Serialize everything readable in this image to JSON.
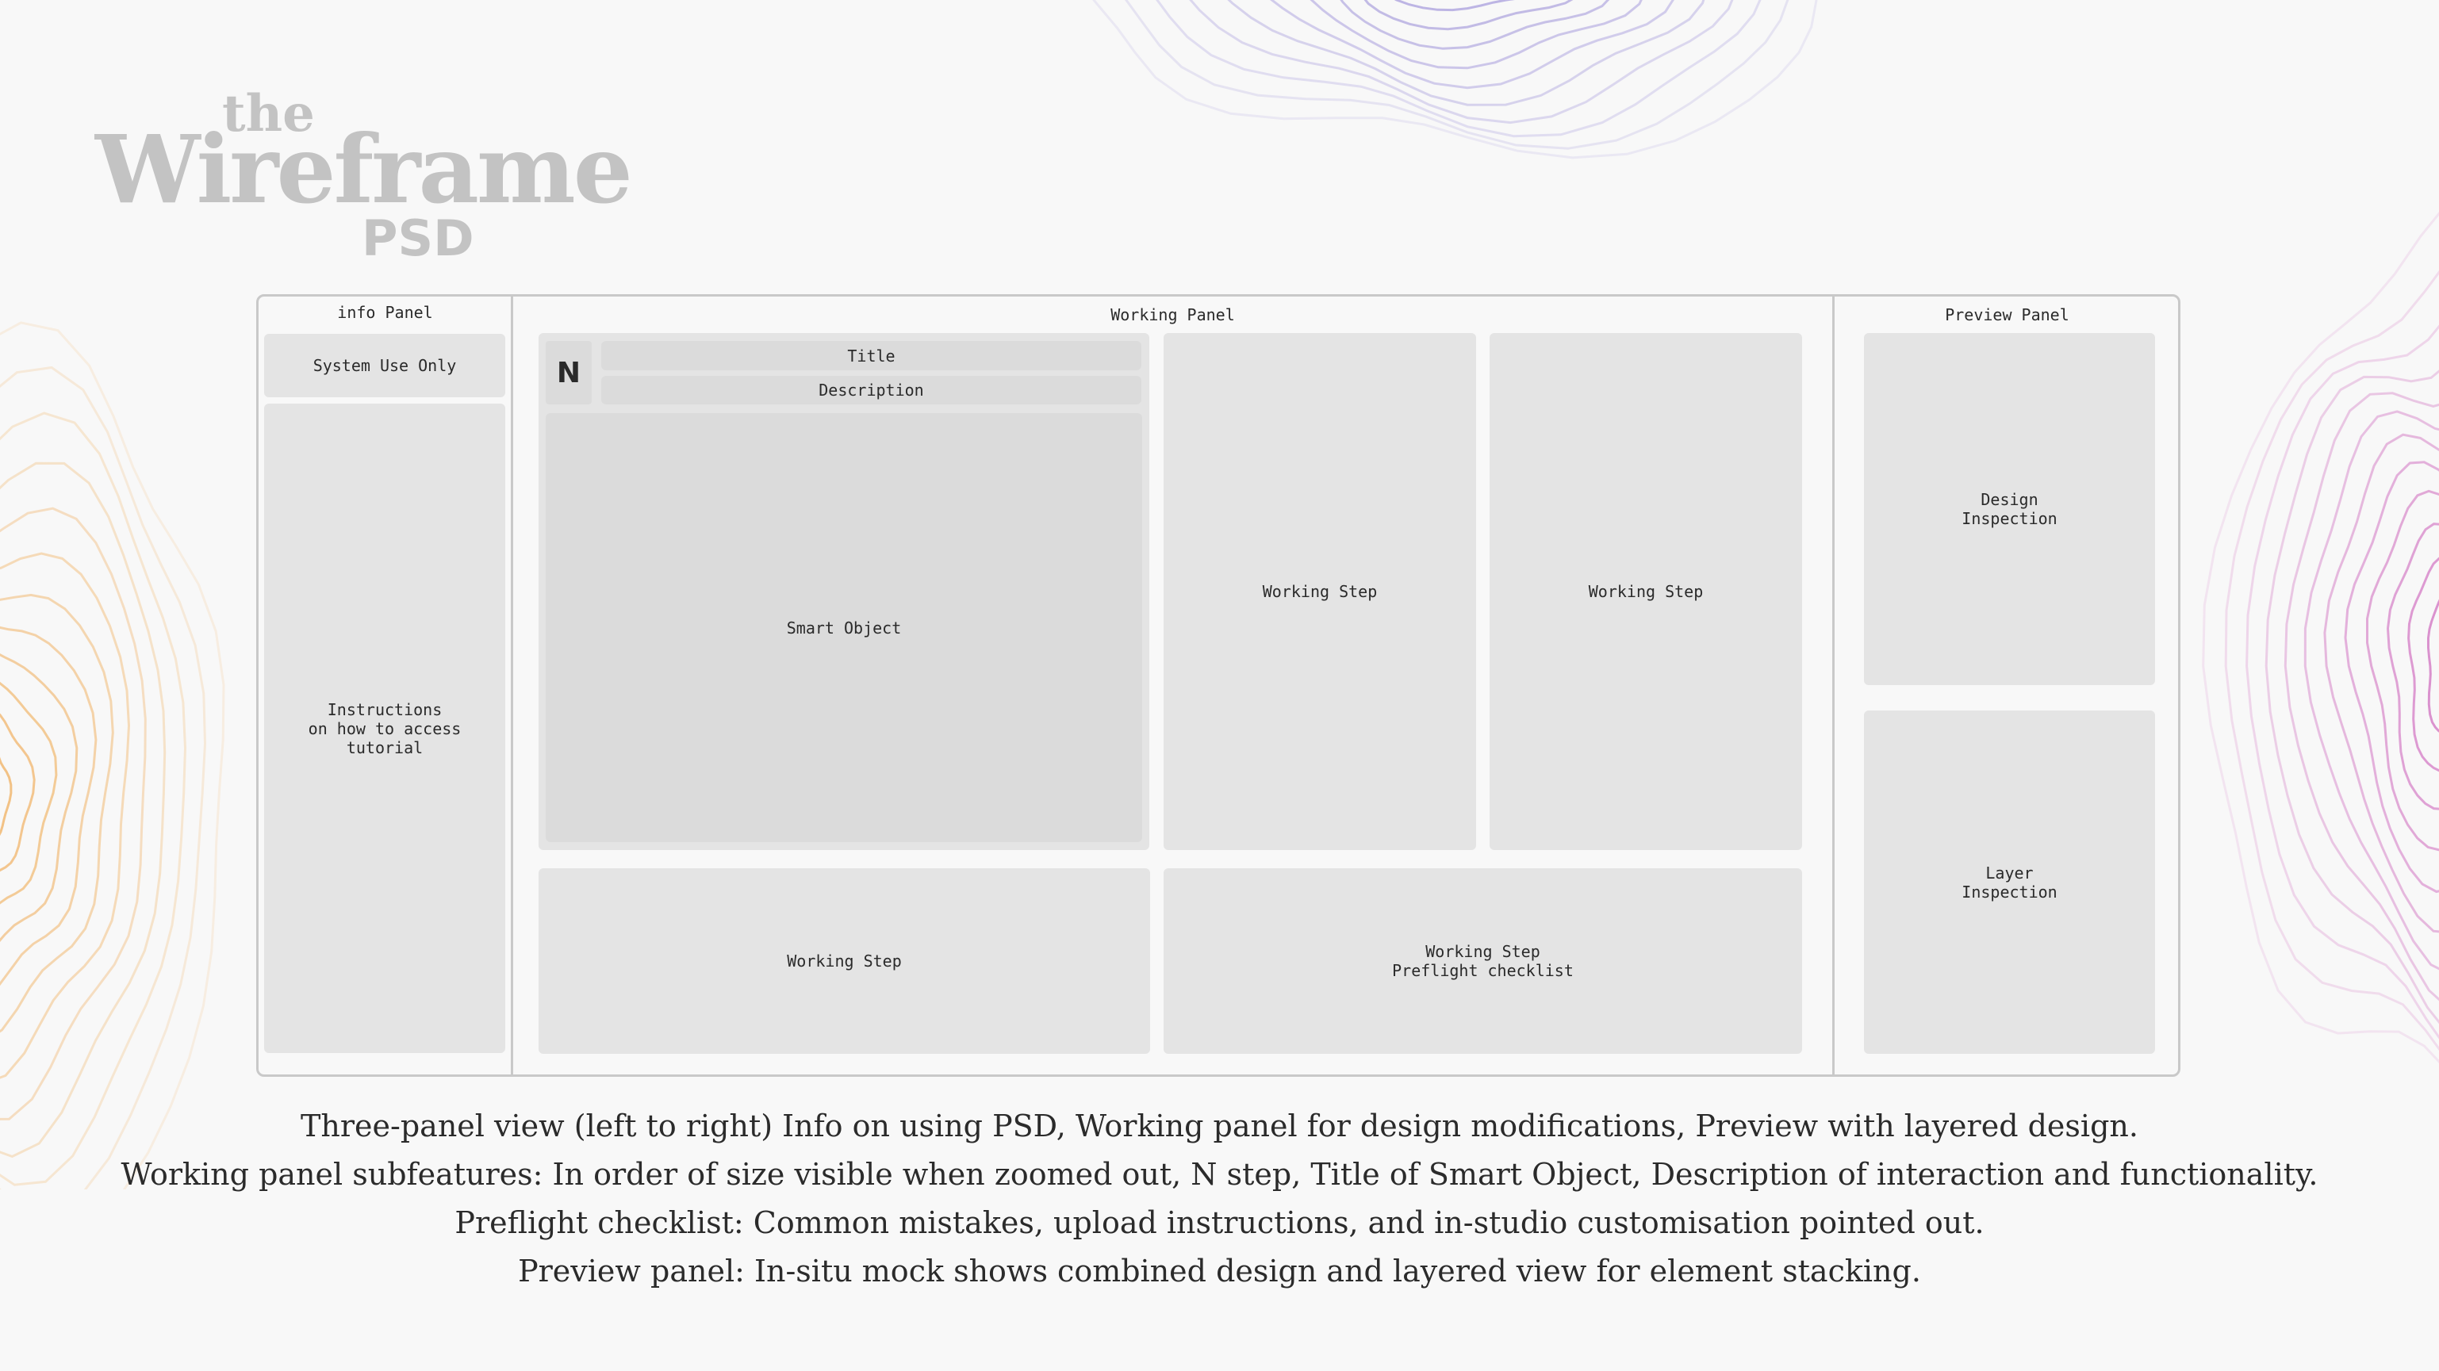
{
  "logo": {
    "top": "the",
    "main": "Wireframe",
    "bottom": "PSD"
  },
  "panels": {
    "info": {
      "title": "info Panel",
      "system": "System Use Only",
      "instructions": "Instructions\non how to access\ntutorial"
    },
    "working": {
      "title": "Working Panel",
      "n_step": "N",
      "title_field": "Title",
      "description_field": "Description",
      "smart_object": "Smart Object",
      "step_a": "Working Step",
      "step_b": "Working Step",
      "step_c": "Working Step",
      "preflight": "Working Step\nPreflight checklist"
    },
    "preview": {
      "title": "Preview Panel",
      "design": "Design\nInspection",
      "layer": "Layer\nInspection"
    }
  },
  "caption": [
    "Three-panel view (left to right) Info on using PSD, Working panel for design modifications, Preview with layered design.",
    "Working panel subfeatures: In order of size visible when zoomed out, N step, Title of Smart Object, Description of interaction and functionality.",
    "Preflight checklist: Common mistakes, upload instructions, and in-studio customisation pointed out.",
    "Preview panel: In-situ mock shows combined design and layered view for element stacking."
  ],
  "colors": {
    "background": "#f8f8f8",
    "box": "#e4e4e4",
    "border": "#c9c9c9",
    "contour_top": "#9b8fd8",
    "contour_left": "#f0b060",
    "contour_right": "#d070c0"
  }
}
